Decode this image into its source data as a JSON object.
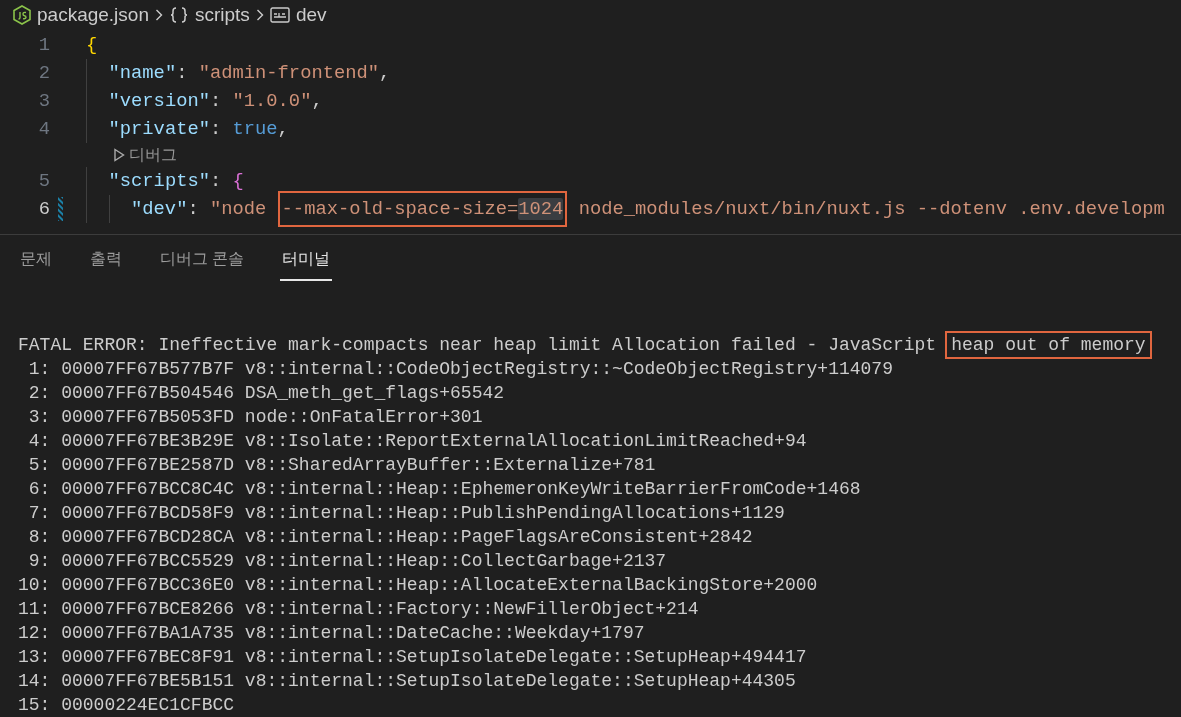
{
  "breadcrumb": [
    {
      "label": "package.json",
      "kind": "file"
    },
    {
      "label": "scripts",
      "kind": "object"
    },
    {
      "label": "dev",
      "kind": "string"
    }
  ],
  "editor": {
    "lines": [
      {
        "kind": "code",
        "number": "1",
        "modified": false,
        "tokens": [
          {
            "kind": "brace",
            "text": "{"
          }
        ]
      },
      {
        "kind": "code",
        "number": "2",
        "modified": false,
        "tokens": [
          {
            "kind": "indent"
          },
          {
            "kind": "key",
            "text": "\"name\""
          },
          {
            "kind": "punct",
            "text": ": "
          },
          {
            "kind": "string",
            "text": "\"admin-frontend\""
          },
          {
            "kind": "punct",
            "text": ","
          }
        ]
      },
      {
        "kind": "code",
        "number": "3",
        "modified": false,
        "tokens": [
          {
            "kind": "indent"
          },
          {
            "kind": "key",
            "text": "\"version\""
          },
          {
            "kind": "punct",
            "text": ": "
          },
          {
            "kind": "string",
            "text": "\"1.0.0\""
          },
          {
            "kind": "punct",
            "text": ","
          }
        ]
      },
      {
        "kind": "code",
        "number": "4",
        "modified": false,
        "tokens": [
          {
            "kind": "indent"
          },
          {
            "kind": "key",
            "text": "\"private\""
          },
          {
            "kind": "punct",
            "text": ": "
          },
          {
            "kind": "bool",
            "text": "true"
          },
          {
            "kind": "punct",
            "text": ","
          }
        ]
      },
      {
        "kind": "codelens",
        "label": "디버그"
      },
      {
        "kind": "code",
        "number": "5",
        "modified": false,
        "tokens": [
          {
            "kind": "indent"
          },
          {
            "kind": "key",
            "text": "\"scripts\""
          },
          {
            "kind": "punct",
            "text": ": "
          },
          {
            "kind": "brace2",
            "text": "{"
          }
        ]
      },
      {
        "kind": "code",
        "number": "6",
        "modified": true,
        "tokens": [
          {
            "kind": "indent"
          },
          {
            "kind": "indent"
          },
          {
            "kind": "key",
            "text": "\"dev\""
          },
          {
            "kind": "punct",
            "text": ": "
          },
          {
            "kind": "string",
            "text": "\"node "
          },
          {
            "kind": "string",
            "boxed": true,
            "parts": [
              {
                "text": "--max-old-space-size=",
                "highlighted": false
              },
              {
                "text": "1024",
                "highlighted": true
              }
            ]
          },
          {
            "kind": "string",
            "text": " node_modules/nuxt/bin/nuxt.js --dotenv .env.developm"
          }
        ]
      }
    ]
  },
  "panel_tabs": [
    {
      "label": "문제",
      "selected": false
    },
    {
      "label": "출력",
      "selected": false
    },
    {
      "label": "디버그 콘솔",
      "selected": false
    },
    {
      "label": "터미널",
      "selected": true
    }
  ],
  "terminal": {
    "lines": [
      {
        "segments": [
          {
            "text": "FATAL ERROR: Ineffective mark-compacts near heap limit Allocation failed - JavaScript",
            "boxed": false
          },
          {
            "text": "heap out of memory",
            "boxed": true
          }
        ]
      },
      {
        "segments": [
          {
            "text": " 1: 00007FF67B577B7F v8::internal::CodeObjectRegistry::~CodeObjectRegistry+114079",
            "boxed": false
          }
        ]
      },
      {
        "segments": [
          {
            "text": " 2: 00007FF67B504546 DSA_meth_get_flags+65542",
            "boxed": false
          }
        ]
      },
      {
        "segments": [
          {
            "text": " 3: 00007FF67B5053FD node::OnFatalError+301",
            "boxed": false
          }
        ]
      },
      {
        "segments": [
          {
            "text": " 4: 00007FF67BE3B29E v8::Isolate::ReportExternalAllocationLimitReached+94",
            "boxed": false
          }
        ]
      },
      {
        "segments": [
          {
            "text": " 5: 00007FF67BE2587D v8::SharedArrayBuffer::Externalize+781",
            "boxed": false
          }
        ]
      },
      {
        "segments": [
          {
            "text": " 6: 00007FF67BCC8C4C v8::internal::Heap::EphemeronKeyWriteBarrierFromCode+1468",
            "boxed": false
          }
        ]
      },
      {
        "segments": [
          {
            "text": " 7: 00007FF67BCD58F9 v8::internal::Heap::PublishPendingAllocations+1129",
            "boxed": false
          }
        ]
      },
      {
        "segments": [
          {
            "text": " 8: 00007FF67BCD28CA v8::internal::Heap::PageFlagsAreConsistent+2842",
            "boxed": false
          }
        ]
      },
      {
        "segments": [
          {
            "text": " 9: 00007FF67BCC5529 v8::internal::Heap::CollectGarbage+2137",
            "boxed": false
          }
        ]
      },
      {
        "segments": [
          {
            "text": "10: 00007FF67BCC36E0 v8::internal::Heap::AllocateExternalBackingStore+2000",
            "boxed": false
          }
        ]
      },
      {
        "segments": [
          {
            "text": "11: 00007FF67BCE8266 v8::internal::Factory::NewFillerObject+214",
            "boxed": false
          }
        ]
      },
      {
        "segments": [
          {
            "text": "12: 00007FF67BA1A735 v8::internal::DateCache::Weekday+1797",
            "boxed": false
          }
        ]
      },
      {
        "segments": [
          {
            "text": "13: 00007FF67BEC8F91 v8::internal::SetupIsolateDelegate::SetupHeap+494417",
            "boxed": false
          }
        ]
      },
      {
        "segments": [
          {
            "text": "14: 00007FF67BE5B151 v8::internal::SetupIsolateDelegate::SetupHeap+44305",
            "boxed": false
          }
        ]
      },
      {
        "segments": [
          {
            "text": "15: 00000224EC1CFBCC",
            "boxed": false
          }
        ]
      }
    ]
  }
}
